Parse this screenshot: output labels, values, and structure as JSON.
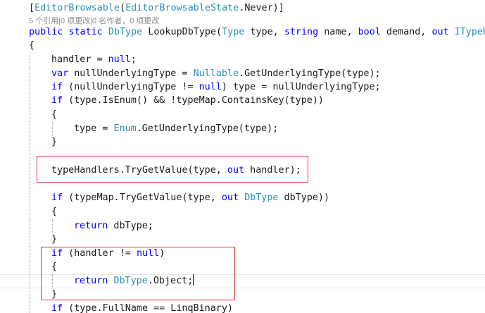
{
  "colors": {
    "background": "#ffffff",
    "keyword": "#0000ff",
    "type": "#2b91af",
    "plain": "#1a1a1a",
    "codelens": "#8a8a8a",
    "highlight_box": "#d9323a"
  },
  "lines": {
    "l0": [
      [
        "[",
        "p"
      ],
      [
        "EditorBrowsable",
        "t"
      ],
      [
        "(",
        "p"
      ],
      [
        "EditorBrowsableState",
        "t"
      ],
      [
        ".Never)]",
        "p"
      ]
    ],
    "lens": "5 个引用|0 项更改|0 名作者，0 项更改",
    "l1": [
      [
        "public",
        "k"
      ],
      [
        " ",
        "p"
      ],
      [
        "static",
        "k"
      ],
      [
        " ",
        "p"
      ],
      [
        "DbType",
        "t"
      ],
      [
        " LookupDbType(",
        "p"
      ],
      [
        "Type",
        "t"
      ],
      [
        " type, ",
        "p"
      ],
      [
        "string",
        "k"
      ],
      [
        " name, ",
        "p"
      ],
      [
        "bool",
        "k"
      ],
      [
        " demand, ",
        "p"
      ],
      [
        "out",
        "k"
      ],
      [
        " ",
        "p"
      ],
      [
        "ITypeHandler",
        "t"
      ]
    ],
    "l2": [
      [
        "{",
        "p"
      ]
    ],
    "l3": [
      [
        "handler = ",
        "p"
      ],
      [
        "null",
        "k"
      ],
      [
        ";",
        "p"
      ]
    ],
    "l4": [
      [
        "var",
        "k"
      ],
      [
        " nullUnderlyingType = ",
        "p"
      ],
      [
        "Nullable",
        "t"
      ],
      [
        ".GetUnderlyingType(type);",
        "p"
      ]
    ],
    "l5": [
      [
        "if",
        "k"
      ],
      [
        " (nullUnderlyingType != ",
        "p"
      ],
      [
        "null",
        "k"
      ],
      [
        ") type = nullUnderlyingType;",
        "p"
      ]
    ],
    "l6": [
      [
        "if",
        "k"
      ],
      [
        " (type.IsEnum() && !typeMap.ContainsKey(type))",
        "p"
      ]
    ],
    "l7": [
      [
        "{",
        "p"
      ]
    ],
    "l8": [
      [
        "type = ",
        "p"
      ],
      [
        "Enum",
        "t"
      ],
      [
        ".GetUnderlyingType(type);",
        "p"
      ]
    ],
    "l9": [
      [
        "}",
        "p"
      ]
    ],
    "l10": [
      [
        "typeHandlers.TryGetValue(type, ",
        "p"
      ],
      [
        "out",
        "k"
      ],
      [
        " handler);",
        "p"
      ]
    ],
    "l11": [
      [
        "if",
        "k"
      ],
      [
        " (typeMap.TryGetValue(type, ",
        "p"
      ],
      [
        "out",
        "k"
      ],
      [
        " ",
        "p"
      ],
      [
        "DbType",
        "t"
      ],
      [
        " dbType))",
        "p"
      ]
    ],
    "l12": [
      [
        "{",
        "p"
      ]
    ],
    "l13": [
      [
        "return",
        "k"
      ],
      [
        " dbType;",
        "p"
      ]
    ],
    "l14": [
      [
        "}",
        "p"
      ]
    ],
    "l15": [
      [
        "if",
        "k"
      ],
      [
        " (handler != ",
        "p"
      ],
      [
        "null",
        "k"
      ],
      [
        ")",
        "p"
      ]
    ],
    "l16": [
      [
        "{",
        "p"
      ]
    ],
    "l17": [
      [
        "return",
        "k"
      ],
      [
        " ",
        "p"
      ],
      [
        "DbType",
        "t"
      ],
      [
        ".Object;",
        "p"
      ]
    ],
    "l18": [
      [
        "}",
        "p"
      ]
    ],
    "l19": [
      [
        "if",
        "k"
      ],
      [
        " (type.FullName == LinqBinary)",
        "p"
      ]
    ]
  }
}
